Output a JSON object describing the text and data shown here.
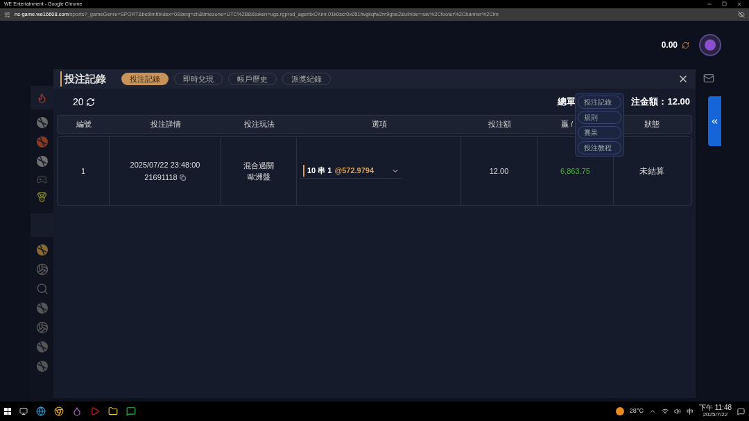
{
  "window": {
    "title": "WE Entertainment - Google Chrome"
  },
  "address_bar": {
    "domain": "nc-game.we16608.com",
    "path": "/sports?_gameGenre=SPORT&betlimitIndex=0&lang=zh&timezone=UTC%2B8&token=ugs.rgprod_agentxCKmr.01k0scr0x051fwgkqfw2m9gbe2&uihide=nav%2Cfooter%2Cbanner%2Cim"
  },
  "balance": "0.00",
  "modal": {
    "title": "投注記錄",
    "tabs": [
      {
        "label": "投注記錄",
        "selected": true
      },
      {
        "label": "即時兌現",
        "selected": false
      },
      {
        "label": "帳戶歷史",
        "selected": false
      },
      {
        "label": "派獎紀錄",
        "selected": false
      }
    ],
    "count": "20",
    "summary_left": "總單",
    "summary_right": "注金額：12.00",
    "columns": [
      "編號",
      "投注詳情",
      "投注玩法",
      "選項",
      "投注額",
      "贏 /",
      "狀態"
    ],
    "rows": [
      {
        "number": "1",
        "datetime": "2025/07/22 23:48:00",
        "bet_id": "21691118",
        "play_type": [
          "混合過關",
          "歐洲盤"
        ],
        "option": "10 串 1",
        "odds": "@572.9794",
        "stake": "12.00",
        "win_loss": "6,863.75",
        "status": "未結算"
      }
    ]
  },
  "help_menu": [
    "投注記錄",
    "規則",
    "賽果",
    "投注教程"
  ],
  "taskbar": {
    "weather": "28°C",
    "ime": "中",
    "time": "下午 11:48",
    "date": "2025/7/22"
  }
}
